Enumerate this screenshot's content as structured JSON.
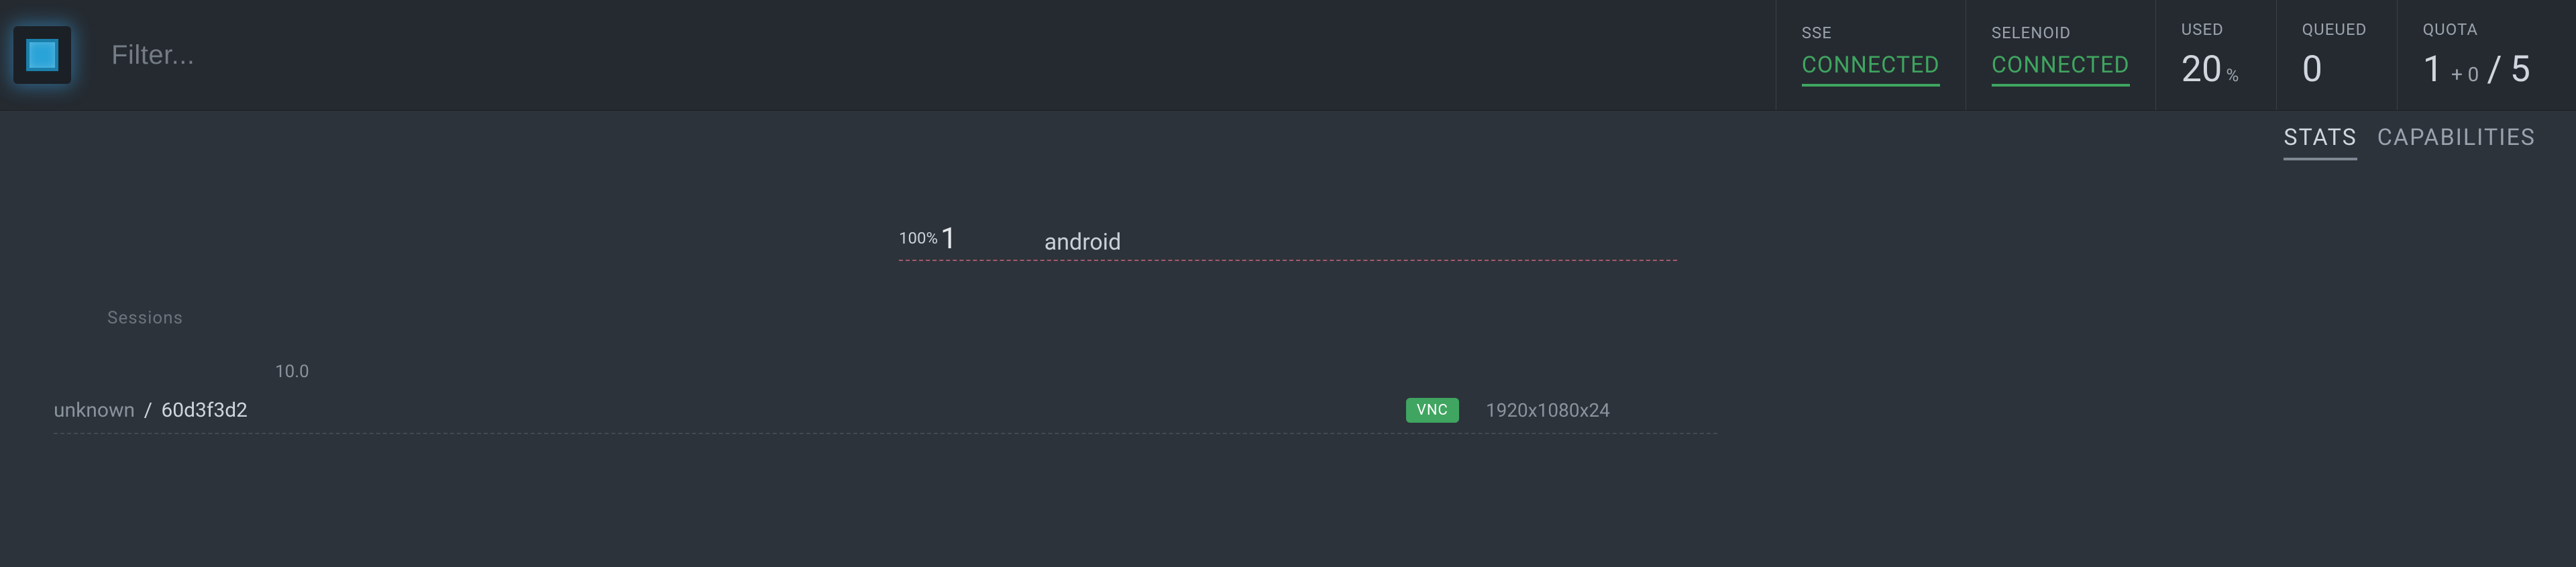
{
  "filter": {
    "placeholder": "Filter..."
  },
  "stats": {
    "sse": {
      "label": "SSE",
      "value": "CONNECTED"
    },
    "selenoid": {
      "label": "SELENOID",
      "value": "CONNECTED"
    },
    "used": {
      "label": "USED",
      "value": "20",
      "unit": "%"
    },
    "queued": {
      "label": "QUEUED",
      "value": "0"
    },
    "quota": {
      "label": "QUOTA",
      "used": "1",
      "plus": "+ 0",
      "total": "5"
    }
  },
  "tabs": {
    "stats": "STATS",
    "capabilities": "CAPABILITIES"
  },
  "browser": {
    "pct": "100%",
    "count": "1",
    "name": "android"
  },
  "sessions": {
    "heading": "Sessions",
    "version": "10.0",
    "items": [
      {
        "name": "unknown",
        "hash": "60d3f3d2",
        "vnc": "VNC",
        "resolution": "1920x1080x24"
      }
    ]
  }
}
